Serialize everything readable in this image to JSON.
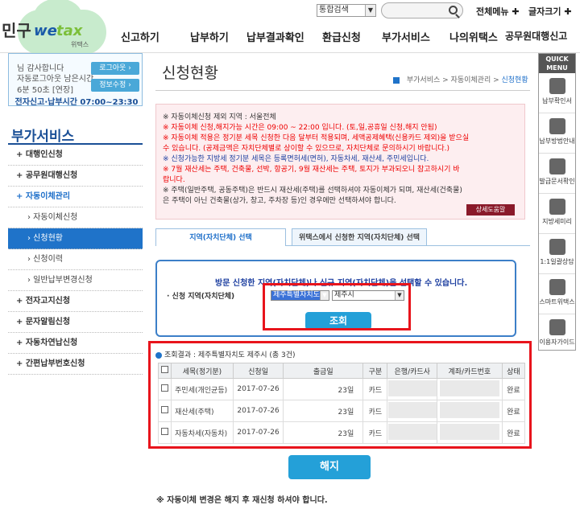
{
  "header": {
    "logo_text": "민구",
    "logo_we": "we",
    "logo_tax": "tax",
    "logo_sub": "위택스",
    "search_scope": "통합검색",
    "all_menu": "전체메뉴",
    "font_size": "글자크기",
    "nav": [
      "신고하기",
      "납부하기",
      "납부결과확인",
      "환급신청",
      "부가서비스",
      "나의위택스",
      "공무원대행신고"
    ]
  },
  "login": {
    "line1": "님 감사합니다",
    "line2": "자동로그아웃 남은시간",
    "line3": "6분 50초 [연장]",
    "logout_btn": "로그아웃",
    "edit_btn": "정보수정",
    "time": "전자신고·납부시간 07:00~23:30"
  },
  "sidebar": {
    "title": "부가서비스",
    "items": [
      {
        "label": "+ 대행인신청"
      },
      {
        "label": "+ 공무원대행신청"
      },
      {
        "label": "+ 자동이체관리"
      },
      {
        "label": "› 자동이체신청"
      },
      {
        "label": "› 신청현황"
      },
      {
        "label": "› 신청이력"
      },
      {
        "label": "› 일반납부변경신청"
      },
      {
        "label": "+ 전자고지신청"
      },
      {
        "label": "+ 문자알림신청"
      },
      {
        "label": "+ 자동차연납신청"
      },
      {
        "label": "+ 간편납부번호신청"
      }
    ]
  },
  "quick": {
    "head": [
      "QUICK",
      "MENU"
    ],
    "items": [
      "납부확인서",
      "납부방법안내",
      "발급문서확인",
      "지방세미리",
      "1:1일괄상담",
      "스마트위택스",
      "이용자가이드"
    ]
  },
  "page": {
    "title": "신청현황",
    "breadcrumb": [
      "부가서비스",
      "자동이체관리",
      "신청현황"
    ]
  },
  "notice": {
    "lines": [
      {
        "text": "※ 자동이체신청 제외 지역 : 서울전체",
        "cls": "dark"
      },
      {
        "text": "※ 자동이체 신청,해지가능 시간은 09:00 ~ 22:00 입니다. (토,일,공휴일 신청,해지 안됨)",
        "cls": "red"
      },
      {
        "text": "※ 자동이체 적용은 정기분 세목 신청한 다음 달부터 적용되며, 세액공제혜택(신용카드 제외)을 받으실",
        "cls": "red"
      },
      {
        "text": "   수 있습니다. (공제금액은 자치단체별로 상이할 수 있으므로, 자치단체로 문의하시기 바랍니다.)",
        "cls": "red"
      },
      {
        "text": "※ 신청가능한 지방세 정기분 세목은 등록면허세(면허), 자동차세, 재산세, 주민세입니다.",
        "cls": "blue"
      },
      {
        "text": "※ 7월 재산세는 주택, 건축물, 선박, 항공기, 9월 재산세는 주택, 토지가 부과되오니 참고하시기 바",
        "cls": "red"
      },
      {
        "text": "   랍니다.",
        "cls": "red"
      },
      {
        "text": "※ 주택(일반주택, 공동주택)은 반드시 재산세(주택)를 선택하셔야 자동이체가 되며, 재산세(건축물)",
        "cls": "dark"
      },
      {
        "text": "   은 주택이 아닌 건축물(상가, 창고, 주차장 등)인 경우에만 선택하셔야 합니다.",
        "cls": "dark"
      }
    ],
    "help_btn": "상세도움말"
  },
  "tabs": {
    "on": "지역(자치단체) 선택",
    "off": "위택스에서 신청한 지역(자치단체) 선택"
  },
  "select": {
    "message": "방문 신청한 지역(자치단체)나 신규 지역(자치단체)을 선택할 수 있습니다.",
    "label": "· 신청 지역(자치단체)",
    "sido": "제주특별자치도",
    "sigungu": "제주시",
    "query_btn": "조회"
  },
  "result": {
    "title": "조회결과 : 제주특별자치도 제주시 (총 3건)",
    "columns": [
      "",
      "세목(정기분)",
      "신청일",
      "출금일",
      "구분",
      "은행/카드사",
      "계좌/카드번호",
      "상태"
    ],
    "rows": [
      {
        "tax": "주민세(개인균등)",
        "date": "2017-07-26",
        "day": "23일",
        "type": "카드",
        "status": "완료"
      },
      {
        "tax": "재산세(주택)",
        "date": "2017-07-26",
        "day": "23일",
        "type": "카드",
        "status": "완료"
      },
      {
        "tax": "자동차세(자동차)",
        "date": "2017-07-26",
        "day": "23일",
        "type": "카드",
        "status": "완료"
      }
    ]
  },
  "cancel_btn": "해지",
  "bottom_note": "※ 자동이체 변경은 해지 후 재신청 하셔야 합니다.",
  "colors": {
    "accent": "#1f73c9",
    "button": "#24a0d8",
    "highlight": "#e8141c",
    "notice_bg": "#fdeef0"
  }
}
